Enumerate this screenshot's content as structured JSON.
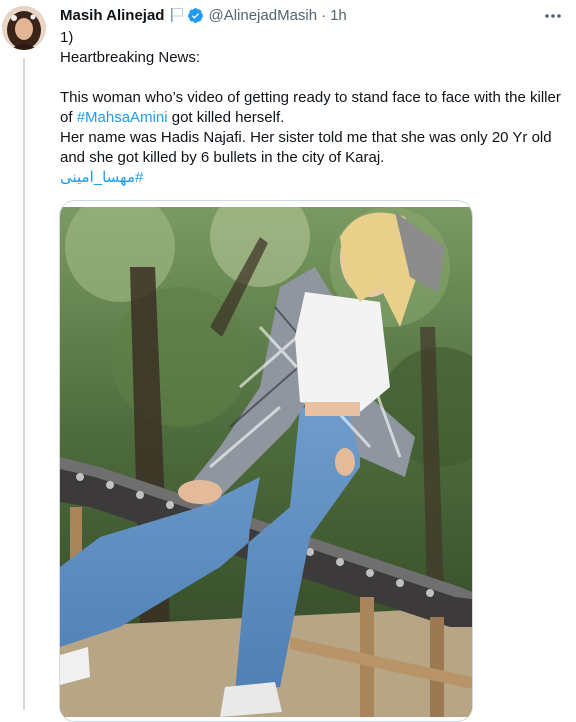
{
  "tweet": {
    "author_name": "Masih Alinejad",
    "handle": "@AlinejadMasih",
    "separator": "·",
    "time": "1h",
    "flag_icon": "white-flag-icon",
    "verified_icon": "verified-badge-icon",
    "more_icon": "more-options-icon",
    "accent_color": "#1d9bf0",
    "text": {
      "line1": "1)",
      "line2": "Heartbreaking News:",
      "line3": "This woman who’s video of getting ready to stand face to face with the killer",
      "line4_prefix": "of ",
      "line4_hashtag": "#MahsaAmini",
      "line4_suffix": " got killed herself.",
      "line5": "Her name was Hadis Najafi. Her sister told me that she was only 20 Yr old",
      "line6": "and she got killed by 6 bullets in the city of Karaj.",
      "hashtag_persian": "#مهسا_امینی"
    },
    "media": {
      "type": "photo"
    }
  }
}
